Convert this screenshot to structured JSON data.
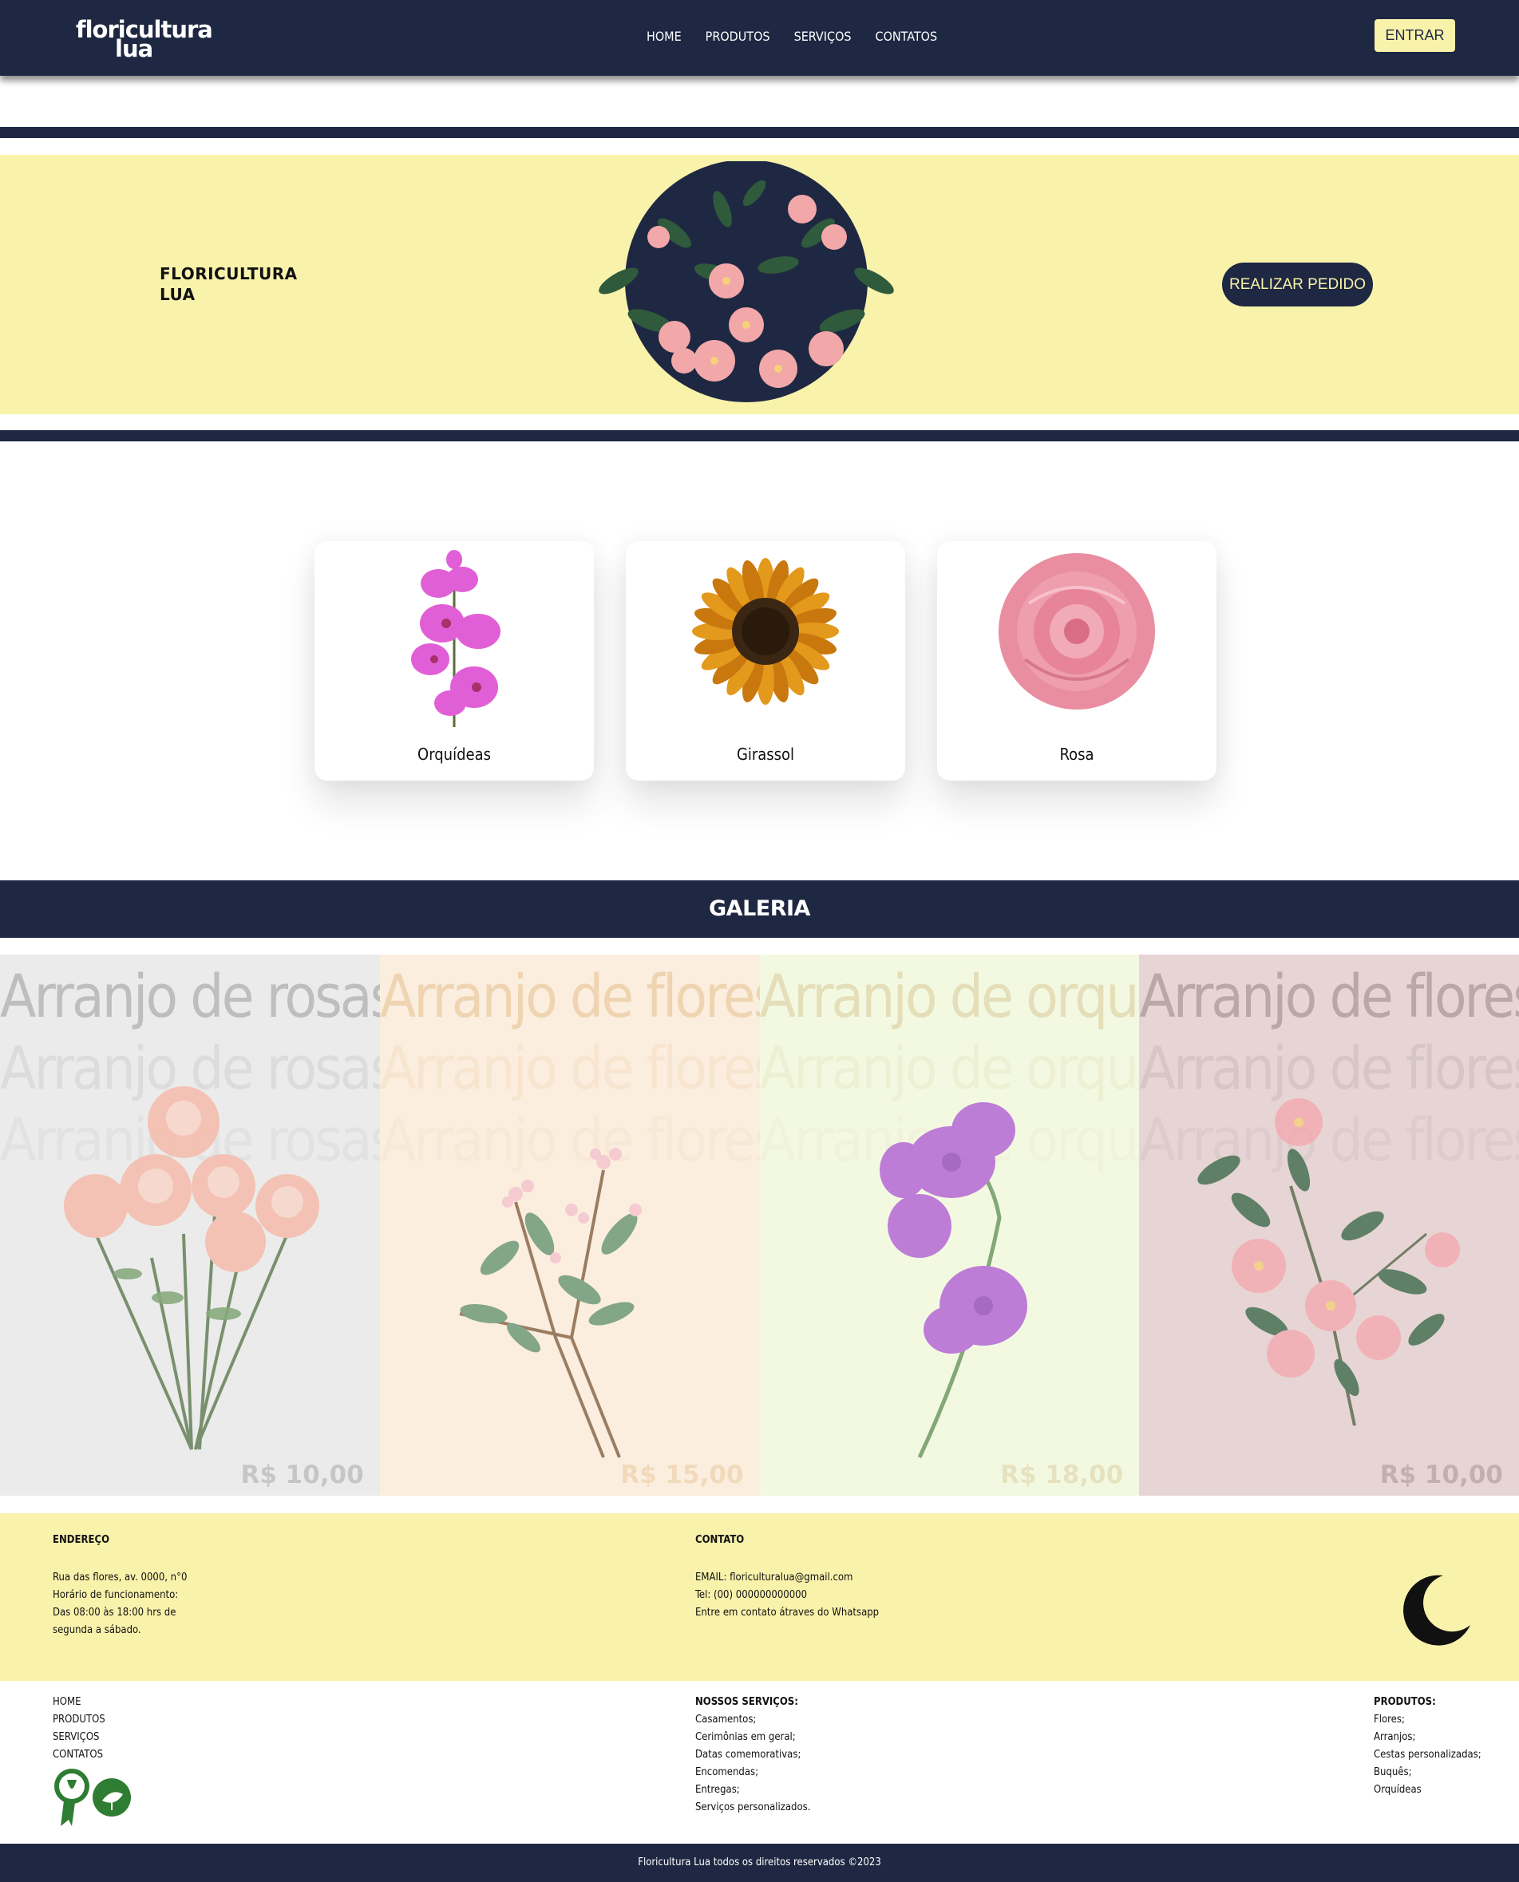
{
  "header": {
    "logo_line1": "floricultura",
    "logo_line2": "lua",
    "nav": [
      "HOME",
      "PRODUTOS",
      "SERVIÇOS",
      "CONTATOS"
    ],
    "login_label": "ENTRAR"
  },
  "hero": {
    "title": "FLORICULTURA LUA",
    "cta_label": "REALIZAR PEDIDO"
  },
  "products": [
    {
      "name": "Orquídeas",
      "icon": "orchid-image"
    },
    {
      "name": "Girassol",
      "icon": "sunflower-image"
    },
    {
      "name": "Rosa",
      "icon": "rose-image"
    }
  ],
  "gallery": {
    "title": "GALERIA",
    "items": [
      {
        "title": "Arranjo de rosas",
        "price": "R$ 10,00",
        "bg": "#ebebeb",
        "text_color": "#9a9a9a"
      },
      {
        "title": "Arranjo de flores",
        "price": "R$ 15,00",
        "bg": "#fbeedf",
        "text_color": "#e6c08e"
      },
      {
        "title": "Arranjo de orquídeas",
        "price": "R$ 18,00",
        "bg": "#f3f9e1",
        "text_color": "#d8c89a"
      },
      {
        "title": "Arranjo de flores",
        "price": "R$ 10,00",
        "bg": "#e7d5d5",
        "text_color": "#9a8080"
      }
    ]
  },
  "footer": {
    "address_heading": "ENDEREÇO",
    "address_lines": [
      "Rua das flores, av. 0000, n°0",
      "Horário de funcionamento:",
      "Das 08:00 às 18:00 hrs de",
      "segunda a sábado."
    ],
    "contact_heading": "CONTATO",
    "contact_lines": [
      "EMAIL: floriculturalua@gmail.com",
      "Tel: (00) 000000000000",
      "Entre em contato átraves do Whatsapp"
    ],
    "links": [
      "HOME",
      "PRODUTOS",
      "SERVIÇOS",
      "CONTATOS"
    ],
    "services_heading": "NOSSOS SERVIÇOS:",
    "services": [
      "Casamentos;",
      "Cerimônias em geral;",
      "Datas comemorativas;",
      "Encomendas;",
      "Entregas;",
      "Serviços personalizados."
    ],
    "products_heading": "PRODUTOS:",
    "products": [
      "Flores;",
      "Arranjos;",
      "Cestas personalizadas;",
      "Buquês;",
      "Orquídeas"
    ],
    "copyright": "Floricultura Lua todos os direitos reservados ©2023"
  },
  "colors": {
    "navy": "#1e2842",
    "cream": "#f9f2ab"
  }
}
